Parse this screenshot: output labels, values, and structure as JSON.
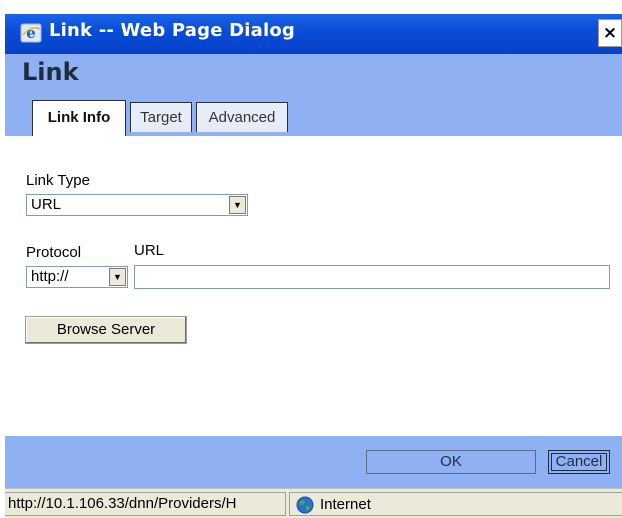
{
  "window": {
    "title": "Link -- Web Page Dialog",
    "close_label": "×",
    "title_icon": "ie-icon"
  },
  "dialog": {
    "heading": "Link",
    "tabs": [
      {
        "label": "Link Info",
        "active": true
      },
      {
        "label": "Target",
        "active": false
      },
      {
        "label": "Advanced",
        "active": false
      }
    ]
  },
  "form": {
    "link_type": {
      "label": "Link Type",
      "value": "URL"
    },
    "protocol": {
      "label": "Protocol",
      "value": "http://"
    },
    "url": {
      "label": "URL",
      "value": ""
    },
    "browse_label": "Browse Server"
  },
  "footer": {
    "ok_label": "OK",
    "cancel_label": "Cancel"
  },
  "statusbar": {
    "url_text": "http://10.1.106.33/dnn/Providers/H",
    "zone_text": "Internet",
    "zone_icon": "globe-icon"
  },
  "colors": {
    "titlebar": "#0a4ed8",
    "dialog_header": "#8fb1f4",
    "heading_text": "#1d2d3f"
  }
}
